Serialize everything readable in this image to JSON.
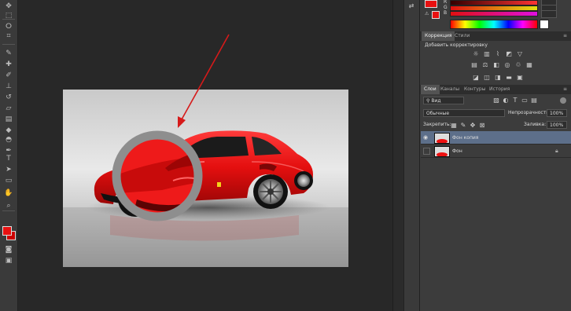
{
  "toolbar": {
    "icons": [
      "move-icon",
      "marquee-icon",
      "lasso-icon",
      "crop-icon",
      "eyedropper-icon",
      "healing-icon",
      "brush-icon",
      "stamp-icon",
      "history-brush-icon",
      "eraser-icon",
      "gradient-icon",
      "blur-icon",
      "dodge-icon",
      "pen-icon",
      "text-icon",
      "path-select-icon",
      "shape-icon",
      "hand-icon",
      "zoom-icon"
    ],
    "foreground_color": "#e81010",
    "background_color": "#cc0000"
  },
  "color_panel": {
    "rows": [
      {
        "label": "R",
        "value": ""
      },
      {
        "label": "G",
        "value": ""
      },
      {
        "label": "B",
        "value": ""
      }
    ]
  },
  "adjustments": {
    "tabs": [
      {
        "label": "Коррекция",
        "active": true
      },
      {
        "label": "Стили",
        "active": false
      }
    ],
    "add_label": "Добавить корректировку"
  },
  "layers_panel": {
    "tabs": [
      {
        "label": "Слои",
        "active": true
      },
      {
        "label": "Каналы",
        "active": false
      },
      {
        "label": "Контуры",
        "active": false
      },
      {
        "label": "История",
        "active": false
      }
    ],
    "filter_label": "Вид",
    "blend_mode": "Обычные",
    "opacity_label": "Непрозрачность:",
    "opacity_value": "100%",
    "lock_label": "Закрепить:",
    "fill_label": "Заливка:",
    "fill_value": "100%",
    "layers": [
      {
        "name": "Фон копия",
        "visible": true,
        "selected": true,
        "locked": false
      },
      {
        "name": "Фон",
        "visible": false,
        "selected": false,
        "locked": true
      }
    ]
  },
  "colors": {
    "accent_selected_layer": "#5d6f8a",
    "car_red": "#e11111",
    "annotation_red": "#d61a1a",
    "magnifier_ring": "#8e8e8e"
  }
}
